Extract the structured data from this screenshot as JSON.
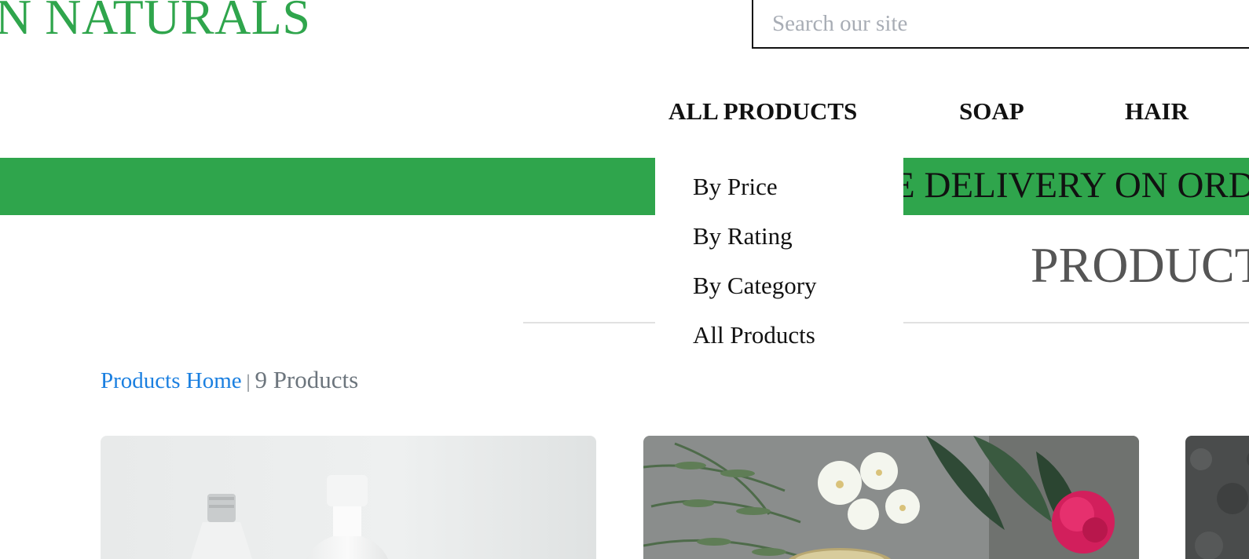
{
  "header": {
    "logo_text": "N NATURALS",
    "search_placeholder": "Search our site",
    "search_value": ""
  },
  "nav": {
    "items": [
      {
        "label": "ALL PRODUCTS"
      },
      {
        "label": "SOAP"
      },
      {
        "label": "HAIR"
      }
    ]
  },
  "dropdown": {
    "items": [
      {
        "label": "By Price"
      },
      {
        "label": "By Rating"
      },
      {
        "label": "By Category"
      },
      {
        "label": "All Products"
      }
    ]
  },
  "banner": {
    "text": "E DELIVERY ON ORDERS",
    "color": "#2fa54c"
  },
  "section": {
    "title": "PRODUCTS"
  },
  "breadcrumb": {
    "link_label": "Products Home",
    "separator": "|",
    "count_label": "9 Products"
  },
  "products": [
    {
      "image": "cosmetic-bottles-photo"
    },
    {
      "image": "flowers-and-herbs-photo"
    },
    {
      "image": "stone-texture-photo"
    }
  ],
  "colors": {
    "brand_green": "#2fa54c",
    "link_blue": "#1a7fe0",
    "muted_text": "#6c757d"
  }
}
